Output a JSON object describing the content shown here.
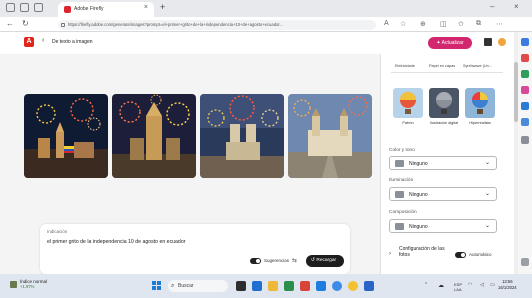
{
  "browser": {
    "tab_title": "Adobe Firefly",
    "tab_close": "×",
    "new_tab": "+",
    "url": "https://firefly.adobe.com/generate/images?prompt=el+primer+grito+de+la+independencia+10+de+agosto+ecuador..."
  },
  "header": {
    "logo": "A",
    "back": "‹",
    "breadcrumb": "De texto a imagen",
    "upgrade_label": "✦ Actualizar"
  },
  "gallery": {
    "images": [
      {
        "name": "fireworks-city-night"
      },
      {
        "name": "fireworks-cathedral"
      },
      {
        "name": "fireworks-plaza-dusk"
      },
      {
        "name": "fireworks-palace-courtyard"
      }
    ]
  },
  "prompt": {
    "label": "Indicación",
    "text": "el primer grito de la independencia 10 de agosto en ecuador",
    "suggestions_label": "Sugerencias",
    "regenerate_label": "↺ Recargar"
  },
  "panel": {
    "tabs": [
      "Eletricidade",
      "Papel en capas",
      "Synthwave (Un..."
    ],
    "styles": [
      {
        "label": "Patrón"
      },
      {
        "label": "Ilustración digital"
      },
      {
        "label": "Hiperrealista"
      }
    ],
    "color_tone": {
      "label": "Color y tono",
      "value": "Ninguno"
    },
    "lighting": {
      "label": "Iluminación",
      "value": "Ninguno"
    },
    "composition": {
      "label": "Composición",
      "value": "Ninguno"
    },
    "comp_settings": {
      "label": "Configuración de las fotos",
      "auto_label": "Automático"
    }
  },
  "taskbar": {
    "weather_title": "Índice normal",
    "weather_value": "+1.97%",
    "search_placeholder": "Buscar",
    "lang": "ESP",
    "lang2": "LAA",
    "time": "13:56",
    "date": "16/1/2024"
  }
}
